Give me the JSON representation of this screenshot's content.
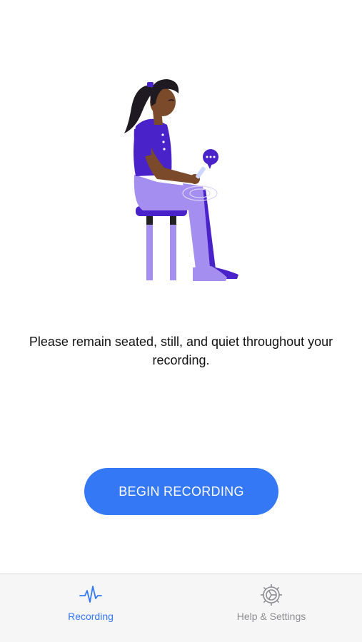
{
  "main": {
    "instruction": "Please remain seated, still, and quiet throughout your recording.",
    "begin_button_label": "BEGIN RECORDING"
  },
  "tab_bar": {
    "tabs": [
      {
        "label": "Recording",
        "icon": "heartbeat-icon",
        "active": true
      },
      {
        "label": "Help & Settings",
        "icon": "gear-icon",
        "active": false
      }
    ]
  },
  "colors": {
    "accent": "#3478f6",
    "inactive_tab": "#8e8e93",
    "illustration_purple": "#4a22c9",
    "illustration_lavender": "#a48ef0"
  }
}
